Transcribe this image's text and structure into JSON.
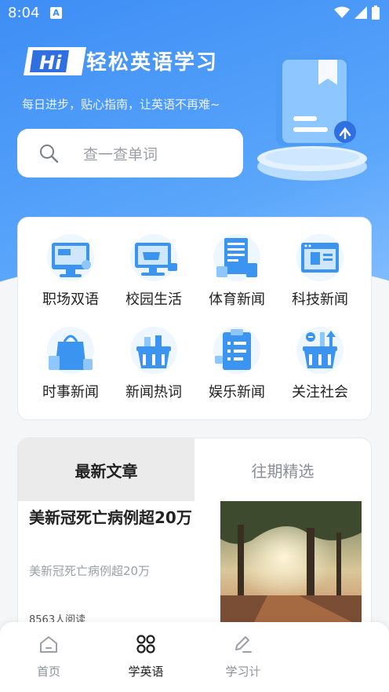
{
  "status_bar": {
    "time": "8:04",
    "notification_letter": "A"
  },
  "header": {
    "logo_text": "Hi",
    "title": "轻松英语学习",
    "subtitle": "每日进步，贴心指南，让英语不再难~"
  },
  "search": {
    "placeholder": "查一查单词"
  },
  "categories": [
    {
      "label": "职场双语",
      "icon": "workplace-icon"
    },
    {
      "label": "校园生活",
      "icon": "campus-icon"
    },
    {
      "label": "体育新闻",
      "icon": "sports-icon"
    },
    {
      "label": "科技新闻",
      "icon": "tech-icon"
    },
    {
      "label": "时事新闻",
      "icon": "current-affairs-icon"
    },
    {
      "label": "新闻热词",
      "icon": "hot-words-icon"
    },
    {
      "label": "娱乐新闻",
      "icon": "entertainment-icon"
    },
    {
      "label": "关注社会",
      "icon": "society-icon"
    }
  ],
  "article_tabs": [
    {
      "label": "最新文章",
      "active": true
    },
    {
      "label": "往期精选",
      "active": false
    }
  ],
  "article": {
    "title": "美新冠死亡病例超20万",
    "summary": "美新冠死亡病例超20万",
    "reads": "8563人阅读"
  },
  "bottom_nav": [
    {
      "label": "首页",
      "icon": "home-icon",
      "active": false
    },
    {
      "label": "学英语",
      "icon": "grid-icon",
      "active": true
    },
    {
      "label": "学习计",
      "icon": "pen-icon",
      "active": false
    }
  ],
  "colors": {
    "primary": "#3d8df5",
    "text": "#222222",
    "muted": "#8a8f96"
  }
}
